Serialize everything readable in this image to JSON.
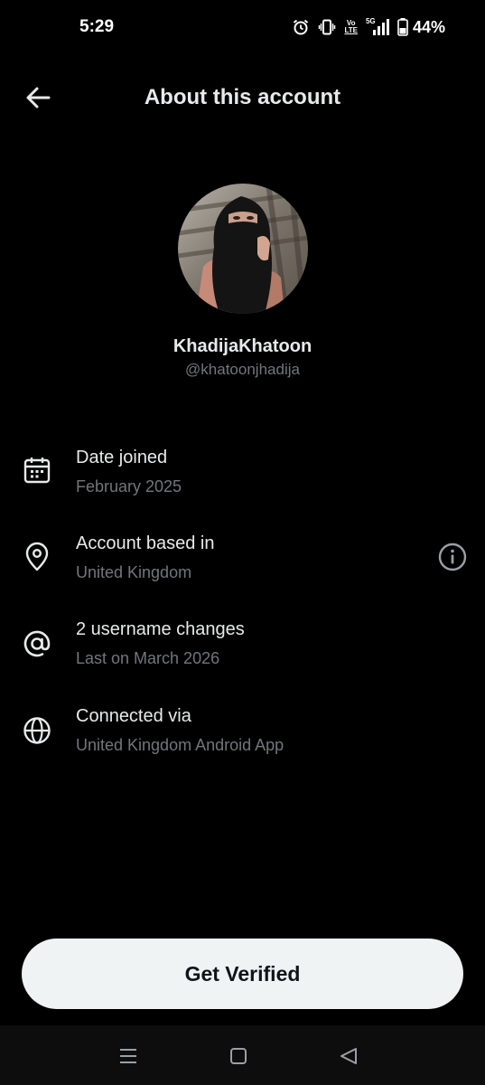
{
  "status_bar": {
    "time": "5:29",
    "battery_percent": "44%",
    "volte_top": "Vo",
    "volte_bottom": "LTE",
    "network": "5G"
  },
  "header": {
    "title": "About this account",
    "back_icon": "arrow-left-icon"
  },
  "profile": {
    "display_name": "KhadijaKhatoon",
    "handle": "@khatoonjhadija"
  },
  "rows": [
    {
      "icon": "calendar-icon",
      "title": "Date joined",
      "subtitle": "February 2025"
    },
    {
      "icon": "location-pin-icon",
      "title": "Account based in",
      "subtitle": "United Kingdom"
    },
    {
      "icon": "at-sign-icon",
      "title": "2 username changes",
      "subtitle": "Last on March 2026"
    },
    {
      "icon": "globe-icon",
      "title": "Connected via",
      "subtitle": "United Kingdom Android App"
    }
  ],
  "cta": {
    "label": "Get Verified"
  },
  "nav": {
    "items": [
      "menu-icon",
      "home-square-icon",
      "back-triangle-icon"
    ]
  },
  "colors": {
    "background": "#000000",
    "primary_text": "#e7e9ea",
    "secondary_text": "#71767b",
    "button_bg": "#eff3f4",
    "button_text": "#0f1419"
  }
}
